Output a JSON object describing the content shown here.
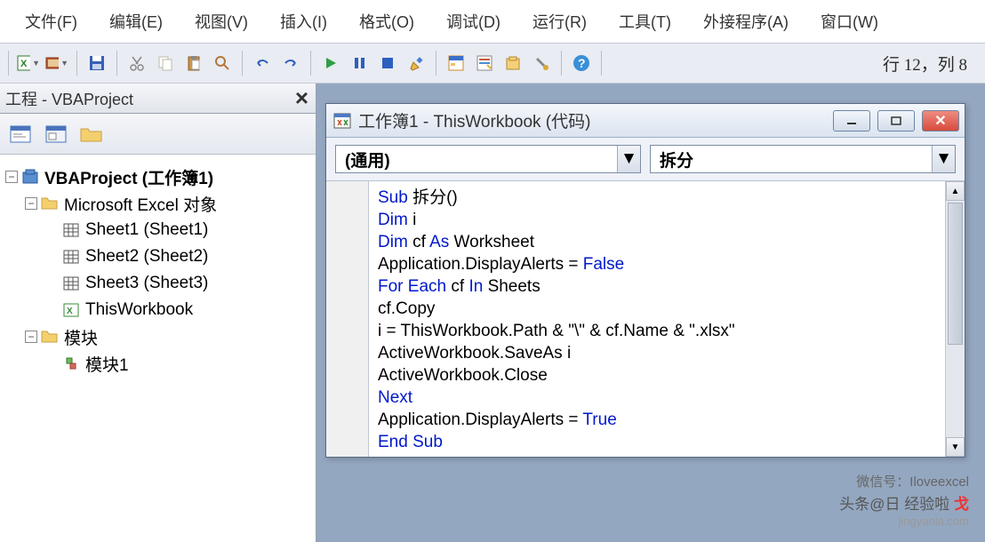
{
  "menubar": {
    "file": "文件(F)",
    "edit": "编辑(E)",
    "view": "视图(V)",
    "insert": "插入(I)",
    "format": "格式(O)",
    "debug": "调试(D)",
    "run": "运行(R)",
    "tools": "工具(T)",
    "addin": "外接程序(A)",
    "window": "窗口(W)"
  },
  "status": "行 12，列 8",
  "project_panel": {
    "title": "工程 - VBAProject"
  },
  "tree": {
    "root": "VBAProject (工作簿1)",
    "excel_objects": "Microsoft Excel 对象",
    "sheet1": "Sheet1 (Sheet1)",
    "sheet2": "Sheet2 (Sheet2)",
    "sheet3": "Sheet3 (Sheet3)",
    "thisworkbook": "ThisWorkbook",
    "modules": "模块",
    "module1": "模块1"
  },
  "code_window": {
    "title": "工作簿1 - ThisWorkbook (代码)",
    "dd_left": "(通用)",
    "dd_right": "拆分"
  },
  "code": {
    "l1_kw": "Sub ",
    "l1_rest": "拆分()",
    "l2_kw": "Dim ",
    "l2_rest": "i",
    "l3_kw1": "Dim ",
    "l3_mid": "cf ",
    "l3_kw2": "As ",
    "l3_rest": "Worksheet",
    "l4_a": "Application.DisplayAlerts = ",
    "l4_kw": "False",
    "l5_kw1": "For Each ",
    "l5_mid": "cf ",
    "l5_kw2": "In ",
    "l5_rest": "Sheets",
    "l6": "cf.Copy",
    "l7": "i = ThisWorkbook.Path & \"\\\" & cf.Name & \".xlsx\"",
    "l8": "ActiveWorkbook.SaveAs i",
    "l9": "ActiveWorkbook.Close",
    "l10_kw": "Next",
    "l11_a": "Application.DisplayAlerts = ",
    "l11_kw": "True",
    "l12_kw": "End Sub"
  },
  "watermark": {
    "wechat": "微信号：Iloveexcel",
    "line1_a": "头条@日 经验啦 ",
    "line1_b": "戈",
    "line2": "jingyanla.com"
  }
}
